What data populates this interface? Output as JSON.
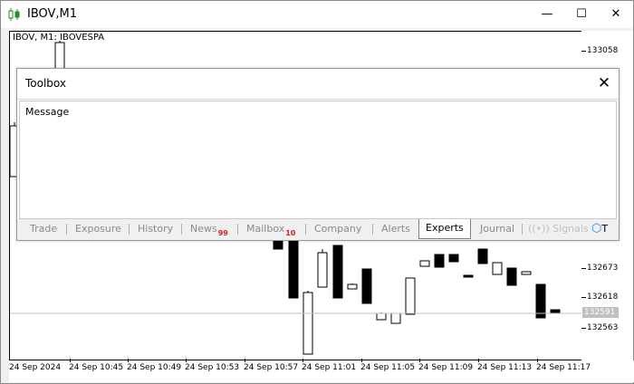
{
  "window": {
    "title": "IBOV,M1",
    "minimize_glyph": "—",
    "maximize_glyph": "☐",
    "close_glyph": "✕"
  },
  "chart": {
    "caption": "IBOV, M1:  IBOVESPA",
    "price_labels": [
      "133058",
      "132673",
      "132618",
      "132563"
    ],
    "current_price": "132591",
    "time_labels": [
      "24 Sep 2024",
      "24 Sep 10:45",
      "24 Sep 10:49",
      "24 Sep 10:53",
      "24 Sep 10:57",
      "24 Sep 11:01",
      "24 Sep 11:05",
      "24 Sep 11:09",
      "24 Sep 11:13",
      "24 Sep 11:17"
    ]
  },
  "toolbox": {
    "title": "Toolbox",
    "close_glyph": "✕",
    "message_header": "Message",
    "tabs": [
      {
        "label": "Trade"
      },
      {
        "label": "Exposure"
      },
      {
        "label": "History"
      },
      {
        "label": "News",
        "badge": "99"
      },
      {
        "label": "Mailbox",
        "badge": "10"
      },
      {
        "label": "Company"
      },
      {
        "label": "Alerts"
      },
      {
        "label": "Experts"
      },
      {
        "label": "Journal"
      },
      {
        "label": "Signals"
      },
      {
        "label": "T"
      }
    ]
  },
  "colors": {
    "bull_candle": "#ffffff",
    "bear_candle": "#000000",
    "badge": "#d02020",
    "current_price_bg": "#c0c0c0"
  }
}
